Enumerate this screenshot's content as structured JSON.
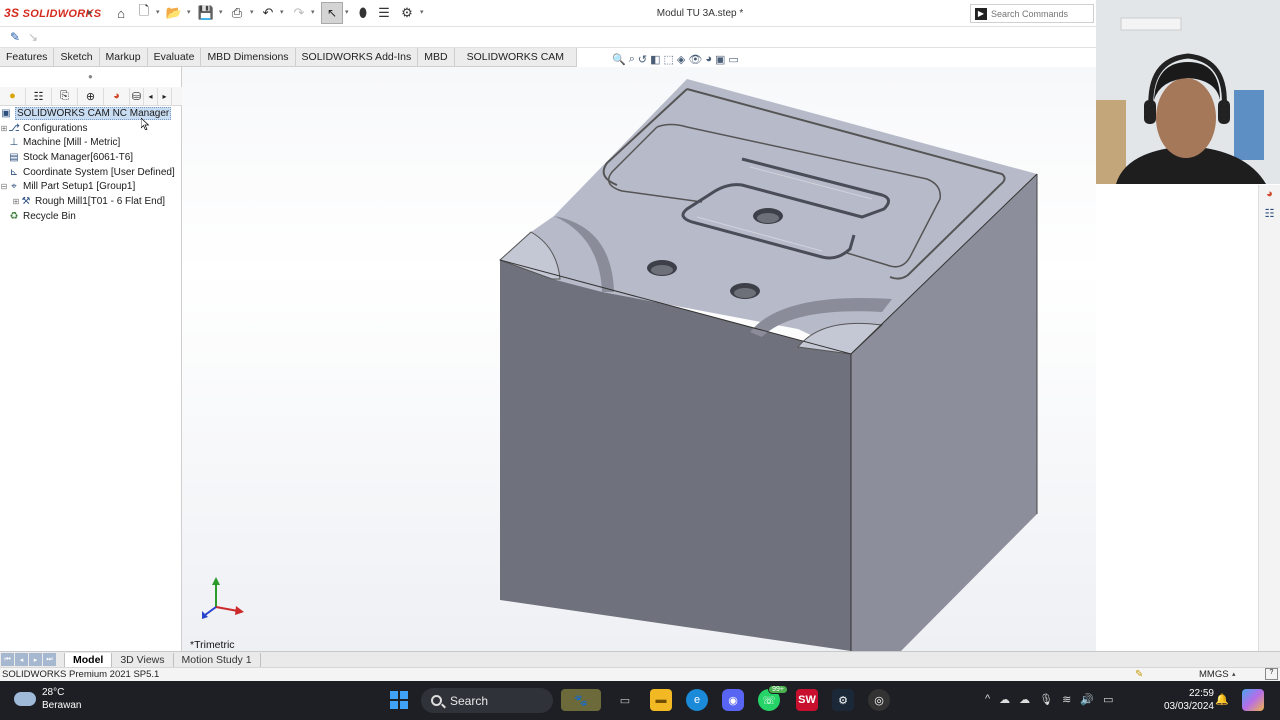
{
  "app": {
    "brand": "SOLIDWORKS",
    "document_title": "Modul TU 3A.step *",
    "search_placeholder": "Search Commands"
  },
  "command_tabs": [
    "Features",
    "Sketch",
    "Markup",
    "Evaluate",
    "MBD Dimensions",
    "SOLIDWORKS Add-Ins",
    "MBD",
    "SOLIDWORKS CAM"
  ],
  "tree": {
    "root": "SOLIDWORKS CAM NC Manager",
    "items": [
      {
        "label": "Configurations",
        "icon": "configurations-icon"
      },
      {
        "label": "Machine [Mill - Metric]",
        "icon": "machine-icon"
      },
      {
        "label": "Stock Manager[6061-T6]",
        "icon": "stock-icon"
      },
      {
        "label": "Coordinate System [User Defined]",
        "icon": "coordinate-system-icon"
      },
      {
        "label": "Mill Part Setup1 [Group1]",
        "icon": "setup-icon"
      },
      {
        "label": "Rough Mill1[T01 - 6 Flat End]",
        "icon": "rough-mill-icon"
      },
      {
        "label": "Recycle Bin",
        "icon": "recycle-bin-icon"
      }
    ]
  },
  "viewport": {
    "view_orientation": "*Trimetric"
  },
  "bottom_tabs": [
    "Model",
    "3D Views",
    "Motion Study 1"
  ],
  "status": {
    "version": "SOLIDWORKS Premium 2021 SP5.1",
    "units": "MMGS"
  },
  "taskbar": {
    "temperature": "28°C",
    "weather": "Berawan",
    "search_label": "Search",
    "time": "22:59",
    "date": "03/03/2024",
    "whatsapp_badge": "99+"
  },
  "colors": {
    "brand_red": "#d52b1e",
    "model_top": "#b9bccb",
    "model_left": "#6f717c",
    "model_right": "#8c8f9b",
    "selection": "#c8dcf2"
  }
}
